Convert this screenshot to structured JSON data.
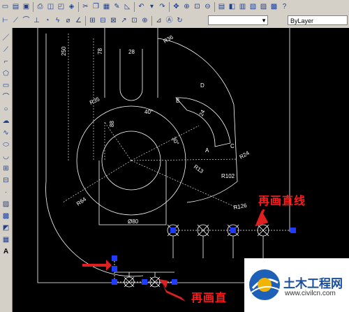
{
  "layer_combo": {
    "value": "ByLayer"
  },
  "callouts": {
    "top": "再画直线",
    "bottom": "再画直"
  },
  "watermark": {
    "name": "土木工程网",
    "url": "www.civilcn.com"
  },
  "drawing": {
    "dimensions": [
      "250",
      "78",
      "28",
      "R36",
      "R35",
      "40°",
      "88",
      "30°",
      "24",
      "R24",
      "R13",
      "R102",
      "R64",
      "R126",
      "Ø80"
    ],
    "points": [
      "D",
      "B",
      "A",
      "C"
    ]
  },
  "colors": {
    "callout": "#ff1a1a",
    "grip": "#1e3cff",
    "canvas": "#000000",
    "linework": "#ffffff"
  }
}
